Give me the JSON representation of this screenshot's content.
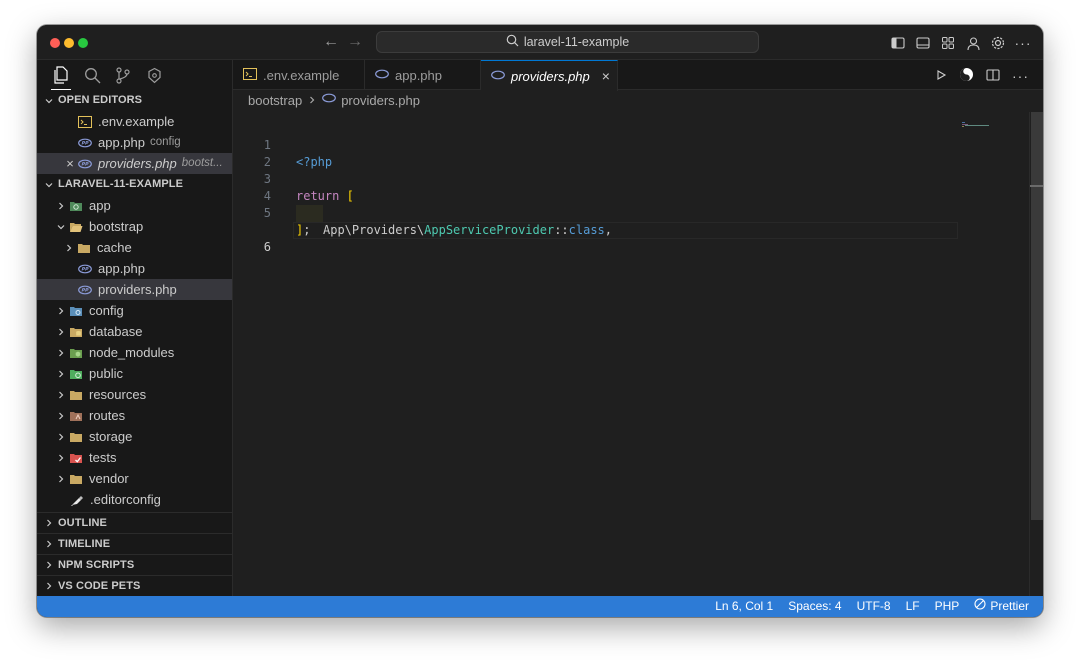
{
  "titlebar": {
    "search_text": "laravel-11-example"
  },
  "sidebar": {
    "open_editors_header": "OPEN EDITORS",
    "open_editors": [
      {
        "name": ".env.example",
        "desc": ""
      },
      {
        "name": "app.php",
        "desc": "config"
      },
      {
        "name": "providers.php",
        "desc": "bootst..."
      }
    ],
    "project_header": "LARAVEL-11-EXAMPLE",
    "tree": {
      "app": "app",
      "bootstrap": "bootstrap",
      "cache": "cache",
      "app_php": "app.php",
      "providers_php": "providers.php",
      "config": "config",
      "database": "database",
      "node_modules": "node_modules",
      "public": "public",
      "resources": "resources",
      "routes": "routes",
      "storage": "storage",
      "tests": "tests",
      "vendor": "vendor",
      "editorconfig": ".editorconfig"
    },
    "outline": "OUTLINE",
    "timeline": "TIMELINE",
    "npm_scripts": "NPM SCRIPTS",
    "vscode_pets": "VS CODE PETS"
  },
  "tabs": [
    {
      "label": ".env.example"
    },
    {
      "label": "app.php"
    },
    {
      "label": "providers.php"
    }
  ],
  "breadcrumb": {
    "folder": "bootstrap",
    "file": "providers.php"
  },
  "code": {
    "line_numbers": [
      "1",
      "2",
      "3",
      "4",
      "5",
      "6"
    ],
    "l1": "<?php",
    "l3_return": "return",
    "l3_bracket": "[",
    "l4_ns": "App\\Providers\\",
    "l4_cls": "AppServiceProvider",
    "l4_sep": "::",
    "l4_kw": "class",
    "l4_comma": ",",
    "l5_bracket": "]",
    "l5_semi": ";"
  },
  "statusbar": {
    "position": "Ln 6, Col 1",
    "spaces": "Spaces: 4",
    "encoding": "UTF-8",
    "eol": "LF",
    "language": "PHP",
    "prettier": "Prettier"
  },
  "colors": {
    "status_bar": "#2d7bd6",
    "accent": "#0078d4",
    "php_icon": "#8b9bd8"
  }
}
